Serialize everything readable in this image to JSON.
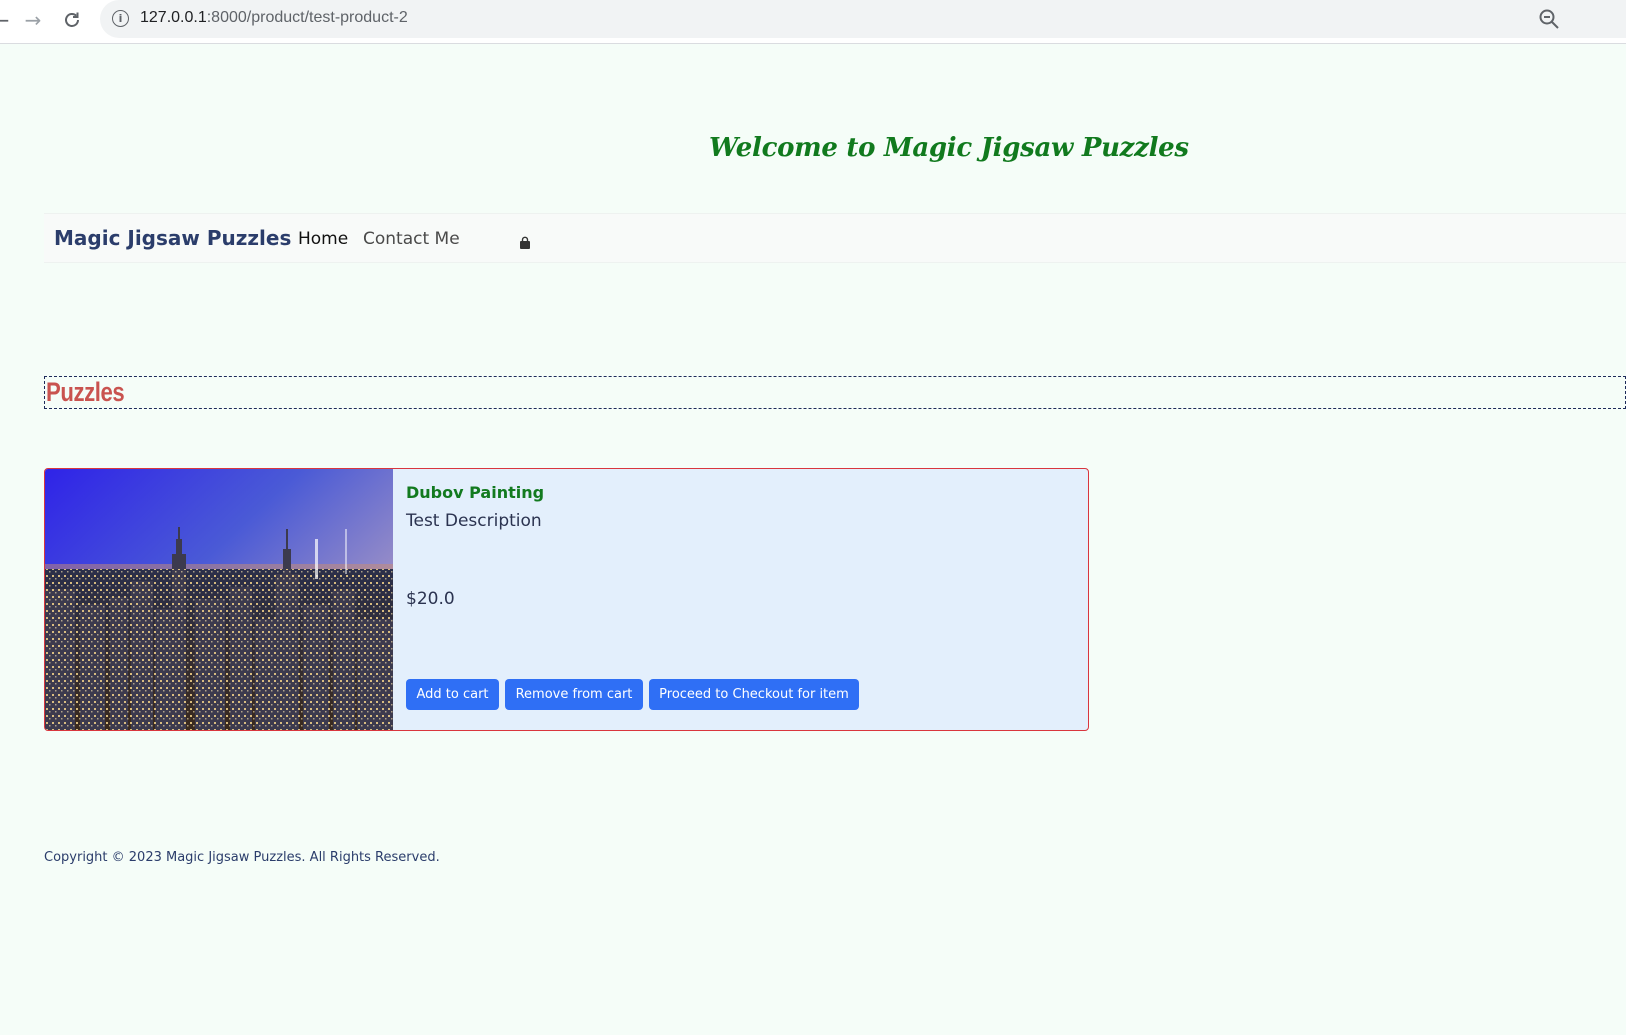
{
  "browser": {
    "url_host": "127.0.0.1",
    "url_path": ":8000/product/test-product-2"
  },
  "header": {
    "welcome": "Welcome to Magic Jigsaw Puzzles"
  },
  "navbar": {
    "brand": "Magic Jigsaw Puzzles",
    "links": [
      {
        "label": "Home"
      },
      {
        "label": "Contact Me"
      }
    ],
    "cart_icon": "shopping-bag-icon"
  },
  "section": {
    "title": "Puzzles"
  },
  "product": {
    "title": "Dubov Painting",
    "description": "Test Description",
    "price": "$20.0",
    "image_icon": "city-skyline-image",
    "buttons": {
      "add": "Add to cart",
      "remove": "Remove from cart",
      "checkout": "Proceed to Checkout for item"
    }
  },
  "footer": {
    "copyright": "Copyright © 2023 Magic Jigsaw Puzzles. All Rights Reserved."
  },
  "colors": {
    "page_bg": "#f5fdf8",
    "welcome_green": "#117a1e",
    "brand_navy": "#2b3d6b",
    "section_red": "#c9534f",
    "card_bg": "#e3effc",
    "card_border": "#d9363e",
    "button_blue": "#2f6ff5"
  }
}
